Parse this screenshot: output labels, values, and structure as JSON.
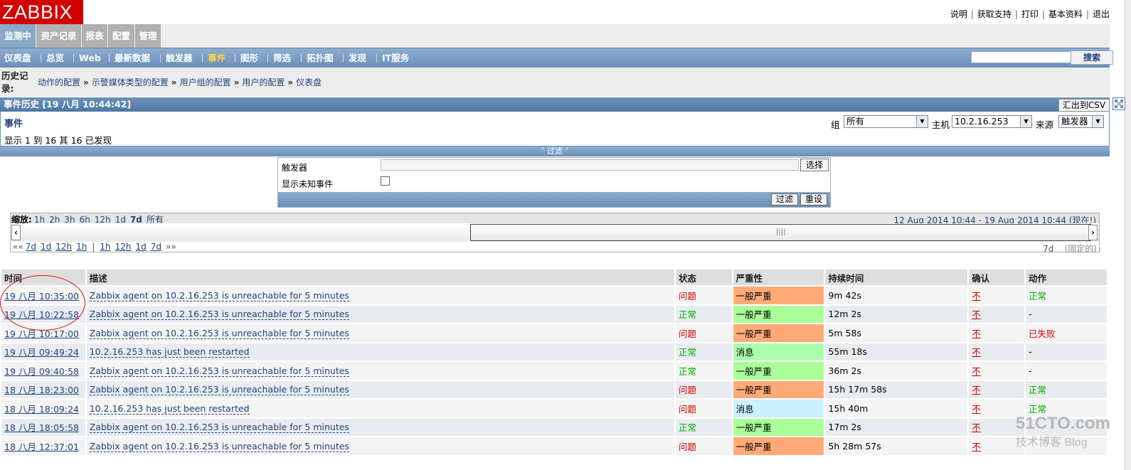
{
  "app": {
    "logo": "ZABBIX"
  },
  "toplinks": [
    "说明",
    "获取支持",
    "打印",
    "基本资料",
    "退出"
  ],
  "mainmenu": [
    {
      "label": "监测中",
      "active": true
    },
    {
      "label": "资产记录",
      "active": false
    },
    {
      "label": "报表",
      "active": false
    },
    {
      "label": "配置",
      "active": false
    },
    {
      "label": "管理",
      "active": false
    }
  ],
  "submenu": [
    {
      "label": "仪表盘",
      "active": false
    },
    {
      "label": "总览",
      "active": false
    },
    {
      "label": "Web",
      "active": false
    },
    {
      "label": "最新数据",
      "active": false
    },
    {
      "label": "触发器",
      "active": false
    },
    {
      "label": "事件",
      "active": true
    },
    {
      "label": "图形",
      "active": false
    },
    {
      "label": "筛选",
      "active": false
    },
    {
      "label": "拓扑图",
      "active": false
    },
    {
      "label": "发现",
      "active": false
    },
    {
      "label": "IT服务",
      "active": false
    }
  ],
  "search": {
    "button": "搜索",
    "value": ""
  },
  "history": {
    "label": "历史记录:",
    "crumbs": [
      "动作的配置",
      "示警媒体类型的配置",
      "用户组的配置",
      "用户的配置",
      "仪表盘"
    ]
  },
  "title": {
    "text": "事件历史 [19 八月 10:44:42]",
    "csv_button": "汇出到CSV"
  },
  "events": {
    "heading": "事件",
    "showing": "显示 1 到 16 其 16 已发现",
    "group_label": "组",
    "group_value": "所有",
    "host_label": "主机",
    "host_value": "10.2.16.253",
    "source_label": "来源",
    "source_value": "触发器"
  },
  "filter": {
    "toggle": "˄ 过滤 ˄",
    "trigger_label": "触发器",
    "trigger_value": "",
    "select_button": "选择",
    "unknown_label": "显示未知事件",
    "unknown_checked": false,
    "filter_button": "过滤",
    "reset_button": "重设"
  },
  "zoom": {
    "label": "缩放:",
    "links": [
      "1h",
      "2h",
      "3h",
      "6h",
      "12h",
      "1d"
    ],
    "current": "7d",
    "all": "所有",
    "range": "12 Aug 2014 10:44  -  19 Aug 2014 10:44 (现在!)",
    "nav_back_arrow": "««",
    "nav_back": [
      "7d",
      "1d",
      "12h",
      "1h"
    ],
    "nav_sep": "|",
    "nav_fwd": [
      "1h",
      "12h",
      "1d",
      "7d"
    ],
    "nav_fwd_arrow": "»»",
    "period": "7d",
    "fixed": "(固定的)",
    "slider_left": "‹",
    "slider_right": "›"
  },
  "table": {
    "headers": [
      "时间",
      "描述",
      "状态",
      "严重性",
      "持续时间",
      "确认",
      "动作"
    ],
    "rows": [
      {
        "time": "19 八月 10:35:00",
        "desc": "Zabbix agent on 10.2.16.253 is unreachable for 5 minutes",
        "status": "问题",
        "status_kind": "problem",
        "severity": "一般严重",
        "sev_kind": "avg",
        "duration": "9m 42s",
        "ack": "不",
        "action": "正常",
        "action_kind": "ok"
      },
      {
        "time": "19 八月 10:22:58",
        "desc": "Zabbix agent on 10.2.16.253 is unreachable for 5 minutes",
        "status": "正常",
        "status_kind": "ok",
        "severity": "一般严重",
        "sev_kind": "avg-ok",
        "duration": "12m 2s",
        "ack": "不",
        "action": "-",
        "action_kind": "none"
      },
      {
        "time": "19 八月 10:17:00",
        "desc": "Zabbix agent on 10.2.16.253 is unreachable for 5 minutes",
        "status": "问题",
        "status_kind": "problem",
        "severity": "一般严重",
        "sev_kind": "avg",
        "duration": "5m 58s",
        "ack": "不",
        "action": "已失败",
        "action_kind": "fail"
      },
      {
        "time": "19 八月 09:49:24",
        "desc": "10.2.16.253 has just been restarted",
        "status": "正常",
        "status_kind": "ok",
        "severity": "消息",
        "sev_kind": "info",
        "duration": "55m 18s",
        "ack": "不",
        "action": "-",
        "action_kind": "none"
      },
      {
        "time": "19 八月 09:40:58",
        "desc": "Zabbix agent on 10.2.16.253 is unreachable for 5 minutes",
        "status": "正常",
        "status_kind": "ok",
        "severity": "一般严重",
        "sev_kind": "avg-ok",
        "duration": "36m 2s",
        "ack": "不",
        "action": "-",
        "action_kind": "none"
      },
      {
        "time": "18 八月 18:23:00",
        "desc": "Zabbix agent on 10.2.16.253 is unreachable for 5 minutes",
        "status": "问题",
        "status_kind": "problem",
        "severity": "一般严重",
        "sev_kind": "avg",
        "duration": "15h 17m 58s",
        "ack": "不",
        "action": "正常",
        "action_kind": "ok"
      },
      {
        "time": "18 八月 18:09:24",
        "desc": "10.2.16.253 has just been restarted",
        "status": "问题",
        "status_kind": "problem",
        "severity": "消息",
        "sev_kind": "info-p",
        "duration": "15h 40m",
        "ack": "不",
        "action": "正常",
        "action_kind": "ok"
      },
      {
        "time": "18 八月 18:05:58",
        "desc": "Zabbix agent on 10.2.16.253 is unreachable for 5 minutes",
        "status": "正常",
        "status_kind": "ok",
        "severity": "一般严重",
        "sev_kind": "avg-ok",
        "duration": "17m 2s",
        "ack": "不",
        "action": "-",
        "action_kind": "none"
      },
      {
        "time": "18 八月 12:37:01",
        "desc": "Zabbix agent on 10.2.16.253 is unreachable for 5 minutes",
        "status": "问题",
        "status_kind": "problem",
        "severity": "一般严重",
        "sev_kind": "avg",
        "duration": "5h 28m 57s",
        "ack": "不",
        "action": "",
        "action_kind": "none"
      }
    ]
  },
  "watermark": {
    "line1": "51CTO.com",
    "line2": "技术博客  Blog"
  },
  "colors": {
    "brand": "#d40000",
    "nav": "#6a8fb7",
    "problem": "#cc0000",
    "ok": "#00aa00",
    "avg": "#ffaa77",
    "avg_ok": "#aaff99",
    "info": "#aaffaa",
    "info_problem": "#ccf0ff"
  }
}
